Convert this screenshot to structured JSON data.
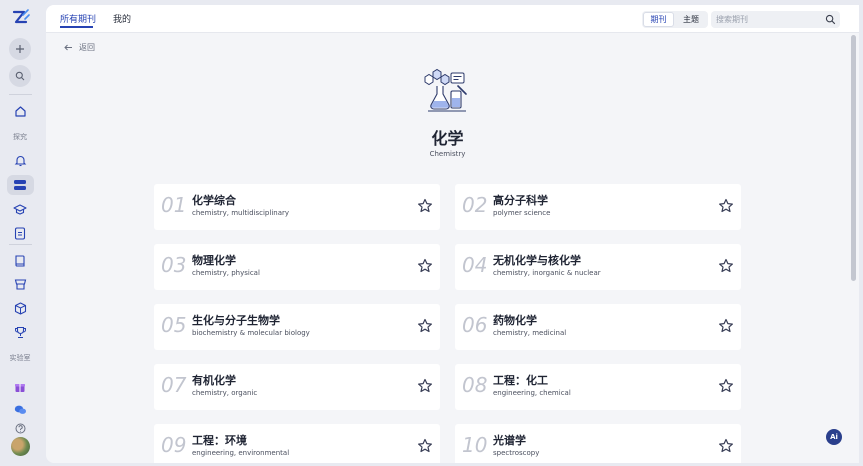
{
  "sidebar": {
    "section_explore": "探究",
    "section_lab": "实验室",
    "accent": "#2743b3"
  },
  "topbar": {
    "tabs": [
      {
        "label": "所有期刊",
        "active": true
      },
      {
        "label": "我的",
        "active": false
      }
    ],
    "segment": {
      "journals": "期刊",
      "topics": "主题",
      "selected": "期刊"
    },
    "search": {
      "placeholder": "搜索期刊",
      "value": ""
    }
  },
  "back_label": "返回",
  "category": {
    "title": "化学",
    "subtitle": "Chemistry"
  },
  "journals": [
    {
      "num": "01",
      "cn": "化学综合",
      "en": "chemistry, multidisciplinary"
    },
    {
      "num": "02",
      "cn": "高分子科学",
      "en": "polymer science"
    },
    {
      "num": "03",
      "cn": "物理化学",
      "en": "chemistry, physical"
    },
    {
      "num": "04",
      "cn": "无机化学与核化学",
      "en": "chemistry, inorganic & nuclear"
    },
    {
      "num": "05",
      "cn": "生化与分子生物学",
      "en": "biochemistry & molecular biology"
    },
    {
      "num": "06",
      "cn": "药物化学",
      "en": "chemistry, medicinal"
    },
    {
      "num": "07",
      "cn": "有机化学",
      "en": "chemistry, organic"
    },
    {
      "num": "08",
      "cn": "工程：化工",
      "en": "engineering, chemical"
    },
    {
      "num": "09",
      "cn": "工程：环境",
      "en": "engineering, environmental"
    },
    {
      "num": "10",
      "cn": "光谱学",
      "en": "spectroscopy"
    }
  ],
  "ai_label": "Ai"
}
